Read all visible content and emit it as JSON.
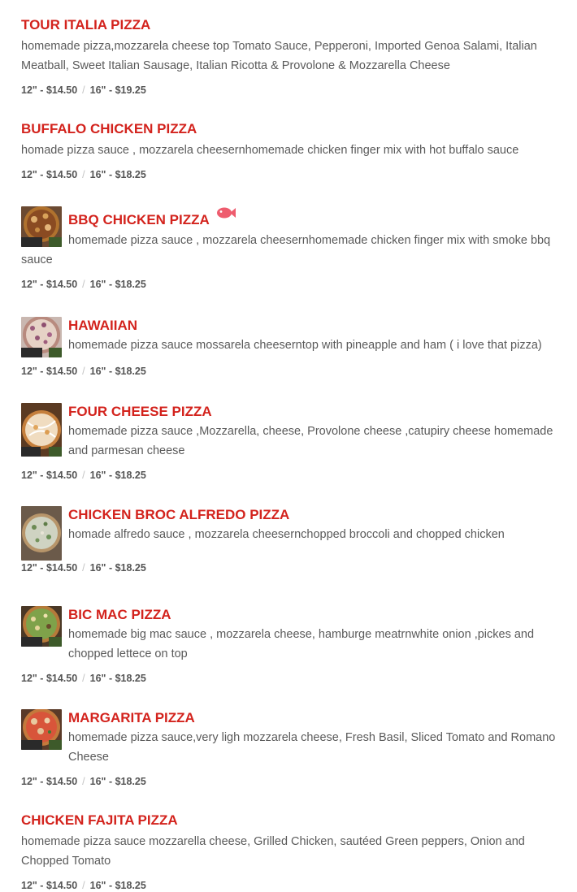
{
  "items": [
    {
      "name": "TOUR ITALIA PIZZA",
      "description": "homemade pizza,mozzarela cheese top Tomato Sauce, Pepperoni, Imported Genoa Salami, Italian Meatball, Sweet Italian Sausage, Italian Ricotta & Provolone & Mozzarella Cheese",
      "price_12": "12\" - $14.50",
      "price_16": "16\" - $19.25"
    },
    {
      "name": "BUFFALO CHICKEN PIZZA",
      "description": "homade pizza sauce , mozzarela cheesernhomemade chicken finger mix with hot buffalo sauce",
      "price_12": "12\" - $14.50",
      "price_16": "16\" - $18.25"
    },
    {
      "name": "BBQ CHICKEN PIZZA",
      "description": "homemade pizza sauce , mozzarela cheesernhomemade chicken finger mix with smoke bbq sauce",
      "price_12": "12\" - $14.50",
      "price_16": "16\" - $18.25",
      "badge_icon": "fish-icon"
    },
    {
      "name": "HAWAIIAN",
      "description": "homemade pizza sauce mossarela cheeserntop with pineapple and ham ( i love that pizza)",
      "price_12": "12\" - $14.50",
      "price_16": "16\" - $18.25"
    },
    {
      "name": "FOUR CHEESE PIZZA",
      "description": "homemade pizza sauce ,Mozzarella, cheese, Provolone cheese ,catupiry cheese homemade and parmesan cheese",
      "price_12": "12\" - $14.50",
      "price_16": "16\" - $18.25"
    },
    {
      "name": "CHICKEN BROC ALFREDO PIZZA",
      "description": "homade alfredo sauce , mozzarela cheesernchopped broccoli and chopped chicken",
      "price_12": "12\" - $14.50",
      "price_16": "16\" - $18.25"
    },
    {
      "name": "BIC MAC PIZZA",
      "description": "homemade big mac sauce , mozzarela cheese, hamburge meatrnwhite onion ,pickes and chopped lettece on top",
      "price_12": "12\" - $14.50",
      "price_16": "16\" - $18.25"
    },
    {
      "name": "MARGARITA PIZZA",
      "description": "homemade pizza sauce,very ligh mozzarela cheese, Fresh Basil, Sliced Tomato and Romano Cheese",
      "price_12": "12\" - $14.50",
      "price_16": "16\" - $18.25"
    },
    {
      "name": "CHICKEN FAJITA PIZZA",
      "description": "homemade pizza sauce mozzarella cheese, Grilled Chicken, sautéed Green peppers, Onion and Chopped Tomato",
      "price_12": "12\" - $14.50",
      "price_16": "16\" - $18.25"
    }
  ],
  "price_separator": "/",
  "colors": {
    "title": "#d3231d",
    "description": "#5a5a5a",
    "price": "#555555",
    "separator": "#c4c4c4"
  }
}
